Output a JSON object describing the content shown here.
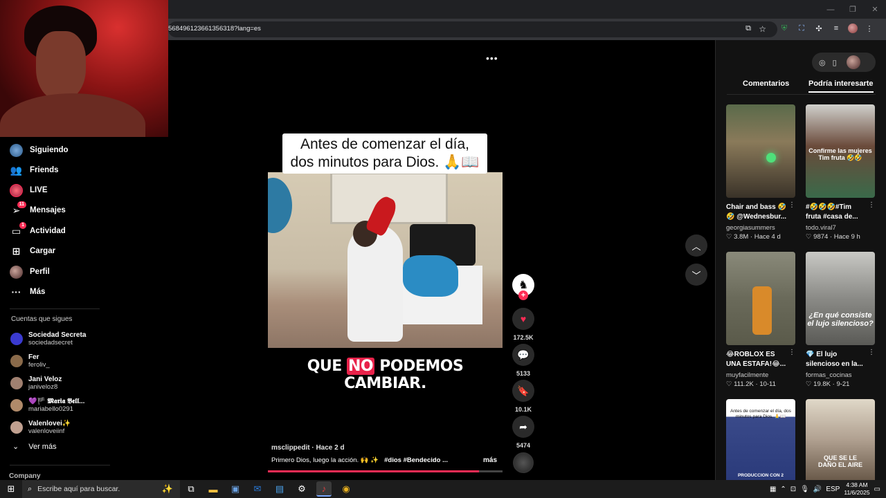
{
  "browser": {
    "url": "568496123661356318?lang=es",
    "window_controls": [
      "—",
      "❐",
      "✕"
    ]
  },
  "sidebar": {
    "items": [
      {
        "label": "Siguiendo"
      },
      {
        "label": "Friends"
      },
      {
        "label": "LIVE"
      },
      {
        "label": "Mensajes",
        "badge": "11"
      },
      {
        "label": "Actividad",
        "badge": "1"
      },
      {
        "label": "Cargar"
      },
      {
        "label": "Perfil"
      },
      {
        "label": "Más"
      }
    ],
    "following_title": "Cuentas que sigues",
    "following": [
      {
        "name": "Sociedad Secreta",
        "user": "sociedadsecret",
        "color": "#3a3ad0"
      },
      {
        "name": "Fer",
        "user": "feroliv_",
        "color": "#8a6a4a"
      },
      {
        "name": "Jani Veloz",
        "user": "janiveloz8",
        "color": "#a08070"
      },
      {
        "name": "💜🏴 𝕸𝖆𝖗𝖎𝖆 𝕭𝖊𝖑𝖑...",
        "user": "mariabello0291",
        "color": "#b08a6a"
      },
      {
        "name": "Valenlovei✨",
        "user": "valenloveiinf",
        "color": "#c0a090"
      }
    ],
    "ver_mas": "Ver más",
    "company": "Company"
  },
  "video": {
    "caption_line1": "Antes de comenzar el día,",
    "caption_line2": "dos minutos para Dios. 🙏📖",
    "subtitle_pre": "QUE ",
    "subtitle_hl": "NO",
    "subtitle_post": " PODEMOS CAMBIAR.",
    "author_meta": "msclippedit · Hace 2 d",
    "description": "Primero Dios, luego la acción. 🙌 ✨",
    "tags": "#dios  #Bendecido  ...",
    "more": "más",
    "progress": 0.9,
    "likes": "172.5K",
    "comments": "5133",
    "saves": "10.1K",
    "shares": "5474"
  },
  "right_panel": {
    "tab_comments": "Comentarios",
    "tab_suggested": "Podría interesarte",
    "cards": [
      {
        "title": "Chair and bass 🤣",
        "title2": "🤣 @Wednesbur...",
        "user": "georgiasummers",
        "likes": "3.8M",
        "age": "Hace 4 d",
        "overlay": ""
      },
      {
        "title": "#🤣🤣🤣#Tim",
        "title2": "fruta #casa de...",
        "user": "todo.viral7",
        "likes": "9874",
        "age": "Hace 9 h",
        "overlay": "Confirme las mujeres Tim fruta 🤣🤣"
      },
      {
        "title": "😂ROBLOX ES",
        "title2": "UNA ESTAFA!😂...",
        "user": "muyfacilmente",
        "likes": "111.2K",
        "age": "10-11",
        "overlay": ""
      },
      {
        "title": "💎 El lujo",
        "title2": "silencioso en la...",
        "user": "formas_cocinas",
        "likes": "19.8K",
        "age": "9-21",
        "overlay": "¿En qué consiste el lujo silencioso?"
      },
      {
        "title": "",
        "title2": "",
        "user": "",
        "likes": "",
        "age": "",
        "overlay": "Antes de comenzar el día, dos minutos para Dios. 🙏📖"
      },
      {
        "title": "",
        "title2": "",
        "user": "",
        "likes": "",
        "age": "",
        "overlay": "QUE SE LE DAÑO EL AIRE"
      }
    ],
    "card5_bottom": "PRODUCCION CON 2"
  },
  "taskbar": {
    "search_placeholder": "Escribe aquí para buscar.",
    "lang": "ESP",
    "time": "4:38 AM",
    "date": "11/6/2025"
  }
}
